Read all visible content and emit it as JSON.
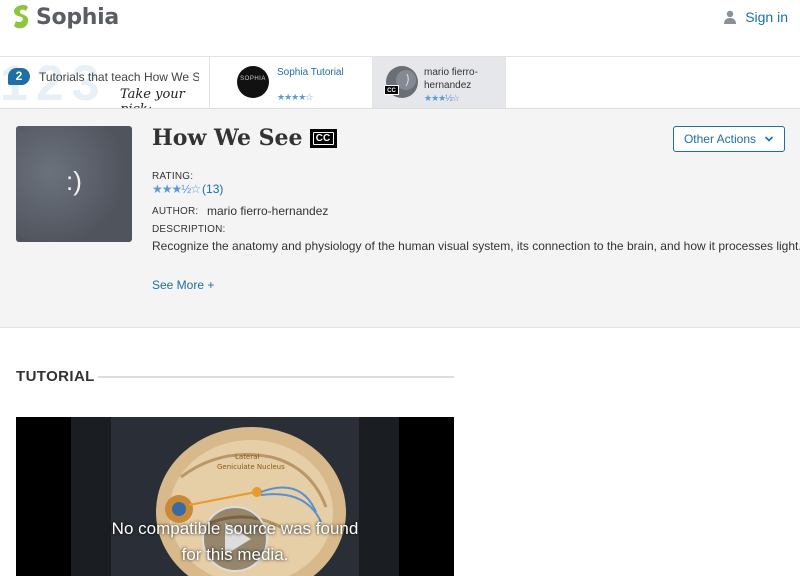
{
  "header": {
    "logo_text": "Sophia",
    "signin_label": "Sign in",
    "brand_color": "#8cc63f",
    "link_color": "#1d6fa5"
  },
  "strip": {
    "count": "2",
    "title": "Tutorials that teach How We See",
    "pick_text": "Take your pick:",
    "cards": [
      {
        "label": "Sophia Tutorial",
        "thumb_text": "SOPHIA",
        "stars": "★★★★☆",
        "rating": 4
      },
      {
        "label": "mario fierro-hernandez",
        "cc": "CC",
        "stars": "★★★½☆",
        "rating": 3.5
      }
    ]
  },
  "hero": {
    "thumb_text": ":)",
    "title": "How We See",
    "cc_label": "CC",
    "other_actions_label": "Other Actions",
    "rating_label": "RATING:",
    "stars": "★★★½☆",
    "rating": 3.5,
    "rating_count": "(13)",
    "author_label": "AUTHOR:",
    "author": "mario fierro-hernandez",
    "description_label": "DESCRIPTION:",
    "description": "Recognize the anatomy and physiology of the human visual system, its connection to the brain, and how it processes light.",
    "see_more_label": "See More +"
  },
  "tutorial": {
    "section_title": "TUTORIAL",
    "video_labels": [
      "Lateral",
      "Geniculate Nucleus"
    ],
    "video_message_line1": "No compatible source was found",
    "video_message_line2": "for this media."
  }
}
